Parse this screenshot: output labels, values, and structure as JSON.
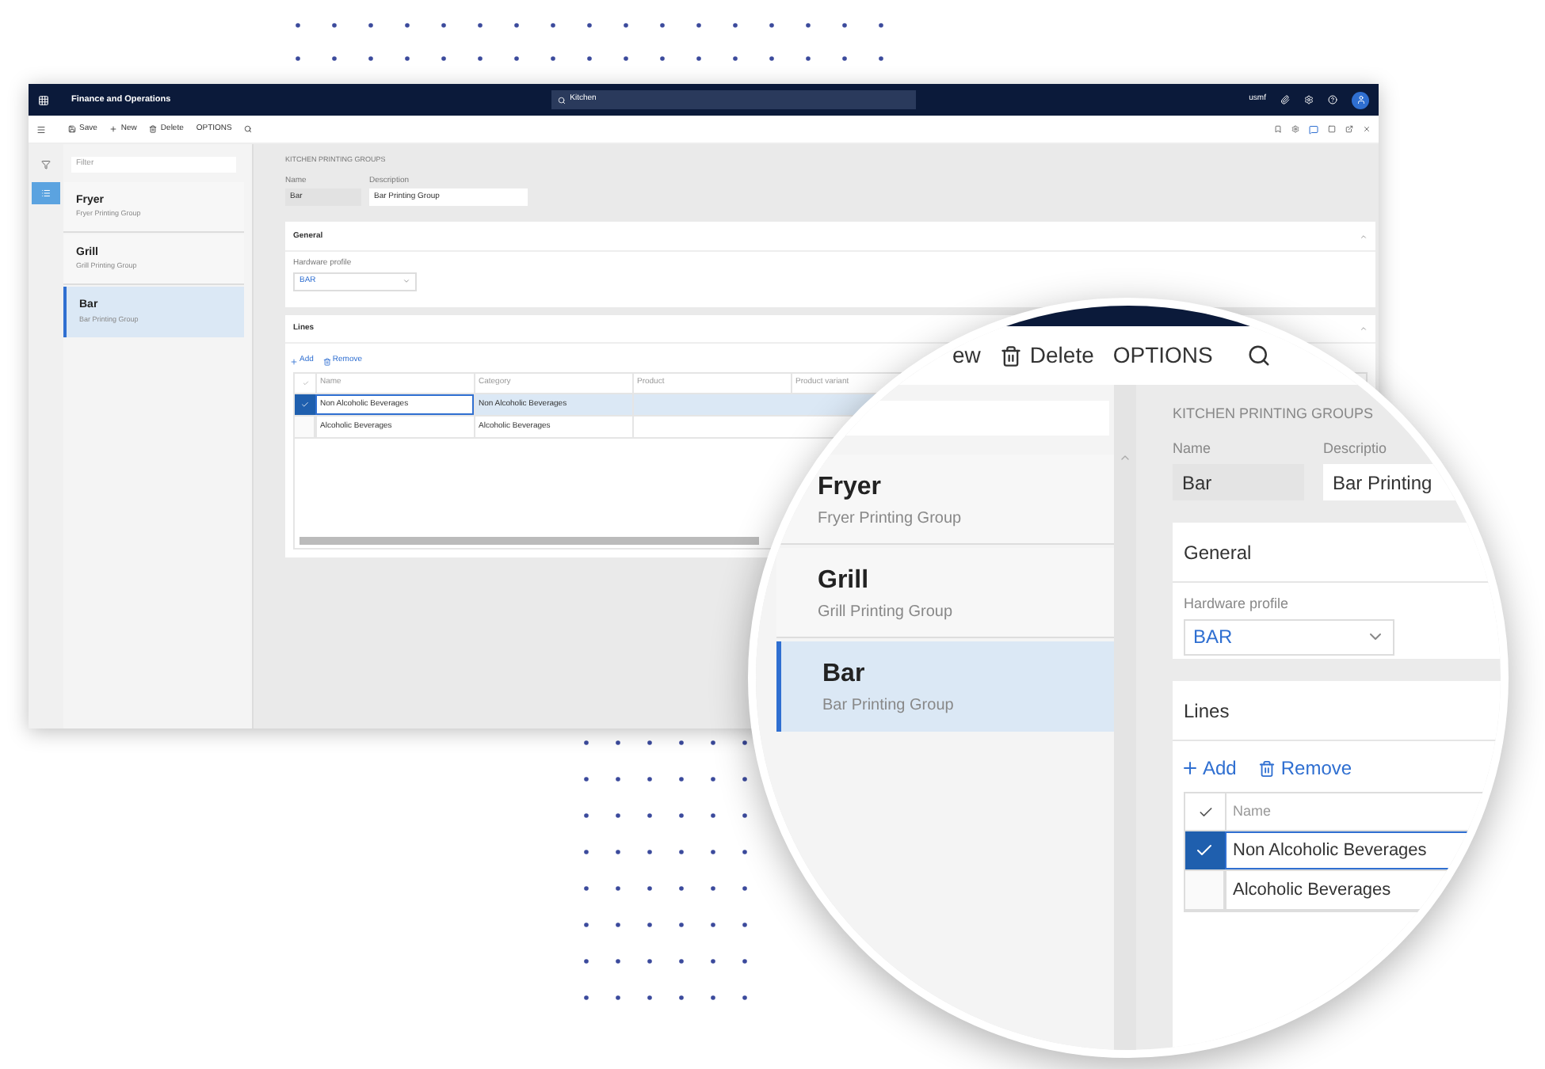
{
  "app_bar": {
    "title": "Finance and Operations",
    "search": "Kitchen",
    "company": "usmf"
  },
  "action_bar": {
    "actions": [
      {
        "kind": "save",
        "label": "Save"
      },
      {
        "kind": "new",
        "label": "New"
      },
      {
        "kind": "delete",
        "label": "Delete"
      },
      {
        "kind": "text",
        "label": "OPTIONS"
      }
    ]
  },
  "filter": {
    "placeholder": "Filter"
  },
  "groups": [
    {
      "name": "Fryer",
      "description": "Fryer Printing Group",
      "selected": false
    },
    {
      "name": "Grill",
      "description": "Grill Printing Group",
      "selected": false
    },
    {
      "name": "Bar",
      "description": "Bar Printing Group",
      "selected": true
    }
  ],
  "form": {
    "section_title": "KITCHEN PRINTING GROUPS",
    "name_label": "Name",
    "name": "Bar",
    "description_label": "Description",
    "description": "Bar Printing Group"
  },
  "general": {
    "title": "General",
    "hardware_profile_label": "Hardware profile",
    "hardware_profile": "BAR"
  },
  "lines": {
    "title": "Lines",
    "add": "Add",
    "remove": "Remove",
    "columns": [
      "Name",
      "Category",
      "Product",
      "Product variant"
    ],
    "rows": [
      {
        "name": "Non Alcoholic Beverages",
        "category": "Non Alcoholic Beverages",
        "selected": true
      },
      {
        "name": "Alcoholic Beverages",
        "category": "Alcoholic Beverages",
        "selected": false
      }
    ]
  },
  "magnifier": {
    "actions": [
      {
        "kind": "text",
        "label": "ew"
      },
      {
        "kind": "delete",
        "label": "Delete"
      },
      {
        "kind": "text",
        "label": "OPTIONS"
      }
    ],
    "section_title": "KITCHEN PRINTING GROUPS",
    "name_label": "Name",
    "description_label": "Descriptio",
    "name": "Bar",
    "description": "Bar Printing",
    "groups": [
      {
        "name": "Fryer",
        "description": "Fryer Printing Group",
        "selected": false
      },
      {
        "name": "Grill",
        "description": "Grill Printing Group",
        "selected": false
      },
      {
        "name": "Bar",
        "description": "Bar Printing Group",
        "selected": true
      }
    ],
    "general_title": "General",
    "hardware_profile_label": "Hardware profile",
    "hardware_profile": "BAR",
    "lines_title": "Lines",
    "add": "Add",
    "remove": "Remove",
    "name_column": "Name",
    "rows": [
      {
        "name": "Non Alcoholic Beverages",
        "selected": true
      },
      {
        "name": "Alcoholic Beverages",
        "selected": false
      }
    ]
  }
}
